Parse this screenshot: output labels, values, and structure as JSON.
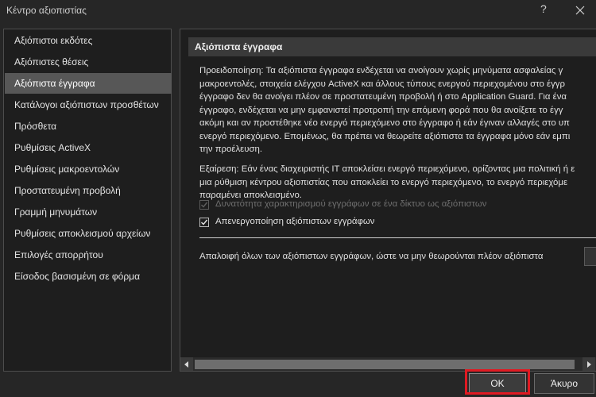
{
  "window": {
    "title": "Κέντρο αξιοπιστίας",
    "help": "?"
  },
  "sidebar": {
    "items": [
      {
        "label": "Αξιόπιστοι εκδότες"
      },
      {
        "label": "Αξιόπιστες θέσεις"
      },
      {
        "label": "Αξιόπιστα έγγραφα",
        "selected": true
      },
      {
        "label": "Κατάλογοι αξιόπιστων προσθέτων"
      },
      {
        "label": "Πρόσθετα"
      },
      {
        "label": "Ρυθμίσεις ActiveX"
      },
      {
        "label": "Ρυθμίσεις μακροεντολών"
      },
      {
        "label": "Προστατευμένη προβολή"
      },
      {
        "label": "Γραμμή μηνυμάτων"
      },
      {
        "label": "Ρυθμίσεις αποκλεισμού αρχείων"
      },
      {
        "label": "Επιλογές απορρήτου"
      },
      {
        "label": "Είσοδος βασισμένη σε φόρμα"
      }
    ]
  },
  "content": {
    "section_title": "Αξιόπιστα έγγραφα",
    "warning_lines": [
      "Προειδοποίηση: Τα αξιόπιστα έγγραφα ενδέχεται να ανοίγουν χωρίς μηνύματα ασφαλείας γ",
      "μακροεντολές, στοιχεία ελέγχου ActiveX και άλλους τύπους ενεργού περιεχομένου στο έγγρ",
      "έγγραφο δεν θα ανοίγει πλέον σε προστατευμένη προβολή ή στο Application Guard. Για ένα",
      "έγγραφο, ενδέχεται να μην εμφανιστεί προτροπή την επόμενη φορά που θα ανοίξετε το έγγ",
      "ακόμη και αν προστέθηκε νέο ενεργό περιεχόμενο στο έγγραφο ή εάν έγιναν αλλαγές στο υπ",
      "ενεργό περιεχόμενο. Επομένως, θα πρέπει να θεωρείτε αξιόπιστα τα έγγραφα μόνο εάν εμπι",
      "την προέλευση."
    ],
    "exception_lines": [
      "Εξαίρεση: Εάν ένας διαχειριστής IT αποκλείσει ενεργό περιεχόμενο, ορίζοντας μια πολιτική ή ε",
      "μια ρύθμιση κέντρου αξιοπιστίας που αποκλείει το ενεργό περιεχόμενο, το ενεργό περιεχόμε",
      "παραμένει αποκλεισμένο."
    ],
    "checkbox_network": {
      "label": "Δυνατότητα χαρακτηρισμού εγγράφων σε ένα δίκτυο ως αξιόπιστων",
      "checked": true,
      "disabled": true
    },
    "checkbox_disable": {
      "label": "Απενεργοποίηση αξιόπιστων εγγράφων",
      "checked": true,
      "disabled": false
    },
    "clear_text": "Απαλοιφή όλων των αξιόπιστων εγγράφων, ώστε να μην θεωρούνται πλέον αξιόπιστα"
  },
  "footer": {
    "ok_label": "OK",
    "cancel_label": "Άκυρο"
  },
  "colors": {
    "highlight": "#e01a22"
  },
  "icons": {
    "close": "close-icon",
    "scroll_left": "arrow-left-icon",
    "scroll_right": "arrow-right-icon",
    "check": "checkmark-icon"
  }
}
